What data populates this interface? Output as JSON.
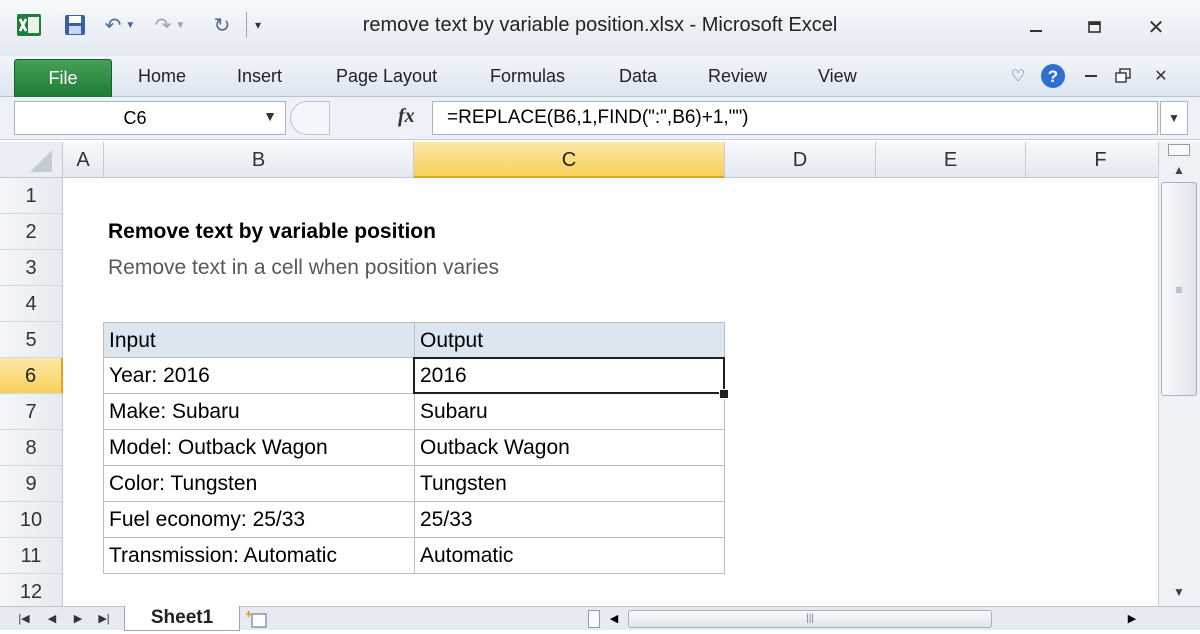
{
  "window": {
    "title": "remove text by variable position.xlsx  -  Microsoft Excel",
    "app_icon": "excel-icon",
    "controls": [
      "minimize-icon",
      "restore-icon",
      "close-icon"
    ]
  },
  "quick_access": [
    "save-icon",
    "undo-icon",
    "redo-icon",
    "repeat-icon",
    "customize-dropdown-icon"
  ],
  "ribbon": {
    "file_tab": "File",
    "tabs": [
      "Home",
      "Insert",
      "Page Layout",
      "Formulas",
      "Data",
      "Review",
      "View"
    ],
    "right_icons": [
      "minimize-ribbon-icon",
      "help-icon",
      "doc-minimize-icon",
      "doc-restore-icon",
      "doc-close-icon"
    ]
  },
  "formula_bar": {
    "name_box": "C6",
    "fx_label": "fx",
    "formula": "=REPLACE(B6,1,FIND(\":\",B6)+1,\"\")"
  },
  "sheet": {
    "columns": [
      "A",
      "B",
      "C",
      "D",
      "E",
      "F"
    ],
    "active_column": "C",
    "rows": [
      "1",
      "2",
      "3",
      "4",
      "5",
      "6",
      "7",
      "8",
      "9",
      "10",
      "11",
      "12"
    ],
    "active_row": "6",
    "selected_cell": "C6",
    "title": "Remove text by variable position",
    "subtitle": "Remove text in a cell when position varies",
    "table": {
      "headers": [
        "Input",
        "Output"
      ],
      "rows": [
        [
          "Year: 2016",
          "2016"
        ],
        [
          "Make: Subaru",
          "Subaru"
        ],
        [
          "Model: Outback Wagon",
          "Outback Wagon"
        ],
        [
          "Color: Tungsten",
          "Tungsten"
        ],
        [
          "Fuel economy: 25/33",
          "25/33"
        ],
        [
          "Transmission: Automatic",
          "Automatic"
        ]
      ]
    },
    "colors": {
      "table_header_fill": "#dce6f1",
      "active_header_fill": "#f8cf5a",
      "file_tab": "#2e8b45",
      "subtitle_text": "#595959"
    }
  },
  "sheet_tabs": {
    "tabs": [
      "Sheet1"
    ],
    "active": "Sheet1"
  }
}
